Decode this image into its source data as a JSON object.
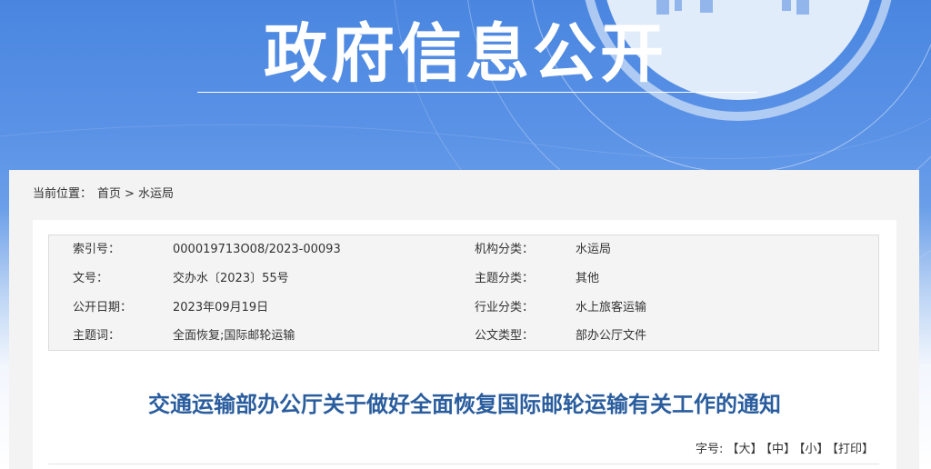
{
  "banner": {
    "title": "政府信息公开"
  },
  "breadcrumb": {
    "label": "当前位置：",
    "home": "首页",
    "separator": ">",
    "current": "水运局"
  },
  "meta": {
    "rows": [
      {
        "k1": "索引号：",
        "v1": "000019713O08/2023-00093",
        "k2": "机构分类：",
        "v2": "水运局"
      },
      {
        "k1": "文号：",
        "v1": "交办水〔2023〕55号",
        "k2": "主题分类：",
        "v2": "其他"
      },
      {
        "k1": "公开日期：",
        "v1": "2023年09月19日",
        "k2": "行业分类：",
        "v2": "水上旅客运输"
      },
      {
        "k1": "主题词：",
        "v1": "全面恢复;国际邮轮运输",
        "k2": "公文类型：",
        "v2": "部办公厅文件"
      }
    ]
  },
  "document": {
    "title": "交通运输部办公厅关于做好全面恢复国际邮轮运输有关工作的通知"
  },
  "font_tools": {
    "label": "字号:",
    "large": "【大】",
    "medium": "【中】",
    "small": "【小】",
    "print": "【打印】"
  },
  "colors": {
    "banner_blue": "#4a86e0",
    "title_blue": "#2a5d9e",
    "card_gray": "#f3f3f3"
  }
}
